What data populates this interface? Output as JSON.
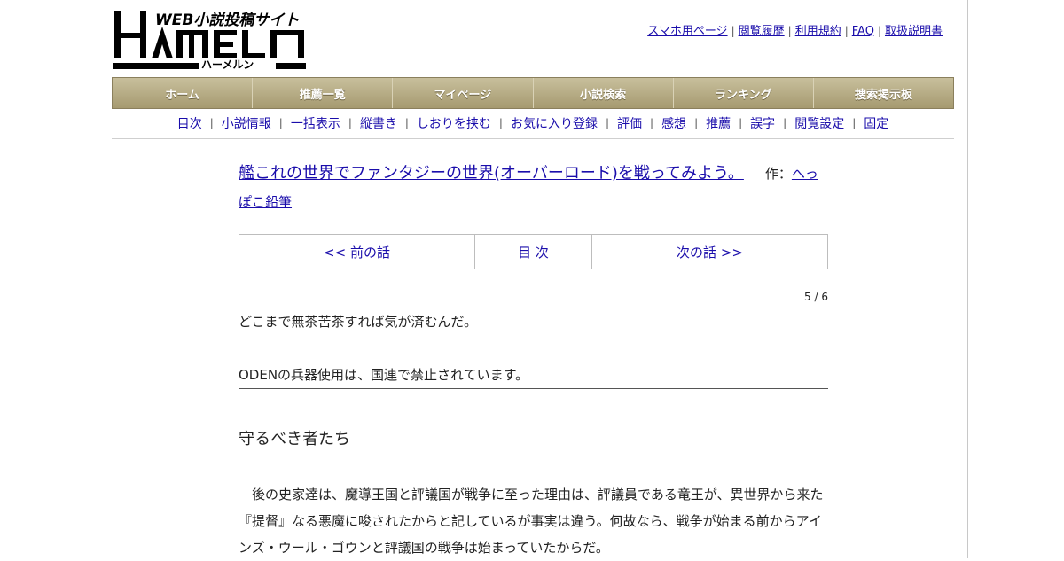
{
  "logo": {
    "title_text": "HAMELN",
    "tagline": "WEB小説投稿サイト",
    "reading": "ハーメルン"
  },
  "top_links": [
    "スマホ用ページ",
    "閲覧履歴",
    "利用規約",
    "FAQ",
    "取扱説明書"
  ],
  "nav": [
    "ホーム",
    "推薦一覧",
    "マイページ",
    "小説検索",
    "ランキング",
    "捜索掲示板"
  ],
  "subnav": [
    "目次",
    "小説情報",
    "一括表示",
    "縦書き",
    "しおりを挟む",
    "お気に入り登録",
    "評価",
    "感想",
    "推薦",
    "誤字",
    "閲覧設定",
    "固定"
  ],
  "novel": {
    "title": "艦これの世界でファンタジーの世界(オーバーロード)を戦ってみよう。",
    "author_prefix": "作：",
    "author": "へっぽこ鉛筆"
  },
  "pager": {
    "prev": "<< 前の話",
    "toc": "目 次",
    "next": "次の話 >>"
  },
  "page_count": "5 / 6",
  "preface": {
    "line1": "どこまで無茶苦茶すれば気が済むんだ。",
    "line2": "ODENの兵器使用は、国連で禁止されています。"
  },
  "chapter_title": "守るべき者たち",
  "body_text": "　後の史家達は、魔導王国と評議国が戦争に至った理由は、評議員である竜王が、異世界から来た『提督』なる悪魔に唆されたからと記しているが事実は違う。何故なら、戦争が始まる前からアインズ・ウール・ゴウンと評議国の戦争は始まっていたからだ。"
}
